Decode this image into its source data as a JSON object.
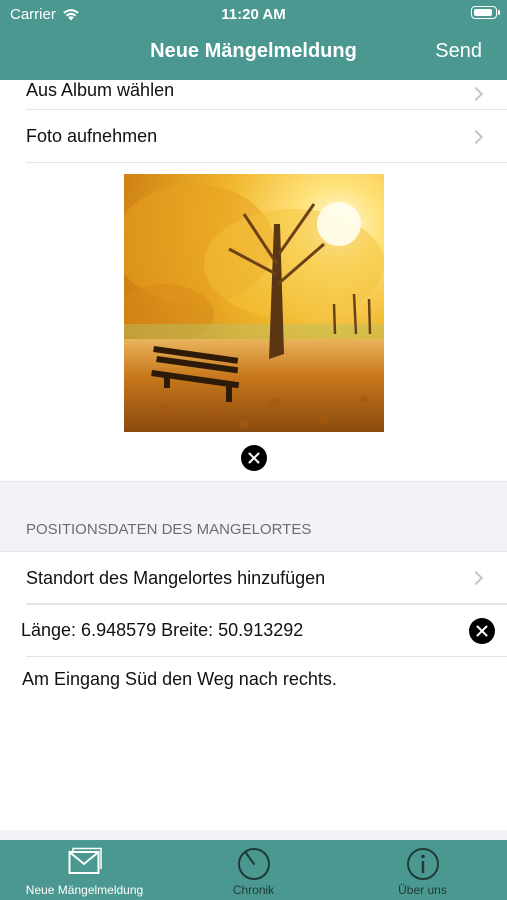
{
  "status_bar": {
    "carrier": "Carrier",
    "time": "11:20 AM",
    "battery_level": 0.9
  },
  "nav": {
    "title": "Neue Mängelmeldung",
    "send_label": "Send"
  },
  "photo_section": {
    "choose_album_label": "Aus Album wählen",
    "take_photo_label": "Foto aufnehmen",
    "photo_icon": "autumn-park-photo",
    "remove_icon": "close-circle-icon"
  },
  "location_section": {
    "header": "POSITIONSDATEN DES MANGELORTES",
    "add_location_label": "Standort des Mangelortes hinzufügen",
    "coordinates": "Länge: 6.948579 Breite: 50.913292",
    "remove_icon": "close-circle-icon"
  },
  "description": "Am Eingang Süd den Weg nach rechts.",
  "tabs": [
    {
      "label": "Neue Mängelmeldung",
      "icon": "envelope-icon",
      "active": true
    },
    {
      "label": "Chronik",
      "icon": "clock-icon",
      "active": false
    },
    {
      "label": "Über uns",
      "icon": "info-icon",
      "active": false
    }
  ],
  "colors": {
    "accent": "#4a9890",
    "background": "#f2f2f7",
    "separator": "#e3e3e8"
  }
}
